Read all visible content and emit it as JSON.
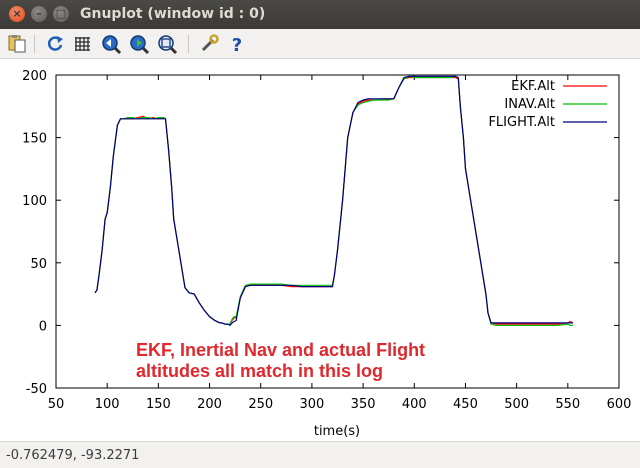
{
  "window": {
    "title": "Gnuplot (window id : 0)"
  },
  "toolbar": {
    "buttons": [
      {
        "icon": "copy-clipboard-icon"
      },
      {
        "icon": "replot-icon"
      },
      {
        "icon": "grid-icon"
      },
      {
        "icon": "zoom-previous-icon"
      },
      {
        "icon": "zoom-next-icon"
      },
      {
        "icon": "autoscale-icon"
      },
      {
        "icon": "settings-icon"
      },
      {
        "icon": "help-icon"
      }
    ]
  },
  "status": {
    "coordinates": "-0.762479, -93.2271"
  },
  "chart_data": {
    "type": "line",
    "xlabel": "time(s)",
    "ylabel": "",
    "xlim": [
      50,
      600
    ],
    "ylim": [
      -50,
      200
    ],
    "xticks": [
      "50",
      "100",
      "150",
      "200",
      "250",
      "300",
      "350",
      "400",
      "450",
      "500",
      "550",
      "600"
    ],
    "yticks": [
      "-50",
      "0",
      "50",
      "100",
      "150",
      "200"
    ],
    "legend_position": "top-right",
    "annotation": [
      "EKF, Inertial Nav and actual Flight",
      "altitudes all match in this log"
    ],
    "series": [
      {
        "name": "EKF.Alt",
        "color": "#ff0000",
        "x": [
          88,
          90,
          92,
          95,
          98,
          100,
          103,
          106,
          110,
          113,
          116,
          120,
          125,
          130,
          135,
          140,
          145,
          150,
          155,
          157,
          160,
          163,
          165,
          168,
          172,
          176,
          180,
          185,
          190,
          195,
          200,
          205,
          210,
          212,
          215,
          218,
          220,
          222,
          224,
          226,
          230,
          235,
          240,
          250,
          260,
          270,
          280,
          290,
          300,
          310,
          320,
          322,
          325,
          330,
          335,
          340,
          345,
          350,
          355,
          360,
          365,
          370,
          375,
          380,
          385,
          390,
          395,
          400,
          405,
          410,
          415,
          420,
          425,
          430,
          435,
          440,
          443,
          445,
          448,
          450,
          455,
          460,
          465,
          470,
          472,
          475,
          480,
          490,
          500,
          510,
          520,
          530,
          540,
          550,
          552,
          555
        ],
        "y": [
          26,
          28,
          40,
          60,
          85,
          90,
          110,
          135,
          160,
          165,
          165,
          165,
          165,
          166,
          167,
          165,
          166,
          165,
          166,
          165,
          140,
          110,
          85,
          70,
          50,
          30,
          26,
          25,
          18,
          12,
          7,
          4,
          2,
          2,
          1,
          1,
          1,
          4,
          6,
          6,
          22,
          31,
          32,
          32,
          32,
          32,
          31,
          31,
          31,
          31,
          31,
          40,
          60,
          100,
          150,
          170,
          177,
          179,
          180,
          180,
          180,
          181,
          181,
          181,
          190,
          197,
          198,
          198,
          198,
          198,
          198,
          198,
          198,
          198,
          198,
          198,
          197,
          175,
          150,
          125,
          100,
          75,
          50,
          25,
          10,
          2,
          1,
          1,
          1,
          1,
          1,
          1,
          1,
          2,
          3,
          2
        ]
      },
      {
        "name": "INAV.Alt",
        "color": "#00c000",
        "x": [
          88,
          90,
          92,
          95,
          98,
          100,
          103,
          106,
          110,
          113,
          116,
          120,
          125,
          130,
          135,
          140,
          145,
          150,
          155,
          157,
          160,
          163,
          165,
          168,
          172,
          176,
          180,
          185,
          190,
          195,
          200,
          205,
          210,
          212,
          215,
          218,
          220,
          222,
          224,
          226,
          230,
          235,
          240,
          250,
          260,
          270,
          280,
          290,
          300,
          310,
          320,
          322,
          325,
          330,
          335,
          340,
          345,
          350,
          355,
          360,
          365,
          370,
          375,
          380,
          385,
          390,
          395,
          400,
          405,
          410,
          415,
          420,
          425,
          430,
          435,
          440,
          443,
          445,
          448,
          450,
          455,
          460,
          465,
          470,
          472,
          475,
          480,
          490,
          500,
          510,
          520,
          530,
          540,
          550,
          552,
          555
        ],
        "y": [
          26,
          28,
          40,
          60,
          85,
          90,
          110,
          135,
          160,
          165,
          165,
          166,
          166,
          165,
          166,
          166,
          165,
          166,
          166,
          165,
          140,
          110,
          85,
          70,
          50,
          30,
          26,
          25,
          18,
          12,
          7,
          4,
          2,
          2,
          1,
          1,
          1,
          5,
          7,
          7,
          23,
          32,
          33,
          33,
          33,
          33,
          32,
          32,
          32,
          32,
          32,
          40,
          60,
          100,
          150,
          170,
          176,
          178,
          179,
          180,
          180,
          180,
          180,
          181,
          190,
          197,
          199,
          198,
          198,
          198,
          198,
          198,
          198,
          198,
          198,
          199,
          198,
          175,
          150,
          125,
          100,
          75,
          50,
          25,
          10,
          1,
          0,
          0,
          0,
          0,
          0,
          0,
          0,
          1,
          0,
          0
        ]
      },
      {
        "name": "FLIGHT.Alt",
        "color": "#000080",
        "x": [
          88,
          90,
          92,
          95,
          98,
          100,
          103,
          106,
          110,
          113,
          116,
          120,
          125,
          130,
          135,
          140,
          145,
          150,
          155,
          157,
          160,
          163,
          165,
          168,
          172,
          176,
          180,
          185,
          190,
          195,
          200,
          205,
          210,
          212,
          215,
          218,
          220,
          222,
          224,
          226,
          230,
          235,
          240,
          250,
          260,
          270,
          280,
          290,
          300,
          310,
          320,
          322,
          325,
          330,
          335,
          340,
          345,
          350,
          355,
          360,
          365,
          370,
          375,
          380,
          385,
          390,
          395,
          400,
          405,
          410,
          415,
          420,
          425,
          430,
          435,
          440,
          443,
          445,
          448,
          450,
          455,
          460,
          465,
          470,
          472,
          475,
          480,
          490,
          500,
          510,
          520,
          530,
          540,
          550,
          552,
          555
        ],
        "y": [
          26,
          28,
          40,
          60,
          85,
          90,
          110,
          135,
          160,
          165,
          165,
          165,
          165,
          165,
          165,
          165,
          165,
          165,
          165,
          165,
          140,
          110,
          85,
          70,
          50,
          30,
          26,
          25,
          18,
          12,
          7,
          4,
          2,
          2,
          1,
          1,
          0,
          2,
          3,
          4,
          22,
          31,
          32,
          32,
          32,
          32,
          32,
          31,
          31,
          31,
          31,
          40,
          60,
          100,
          150,
          170,
          178,
          180,
          181,
          181,
          181,
          181,
          181,
          181,
          190,
          198,
          199,
          199,
          199,
          199,
          199,
          199,
          199,
          199,
          199,
          199,
          198,
          175,
          150,
          125,
          100,
          75,
          50,
          25,
          10,
          2,
          2,
          2,
          2,
          2,
          2,
          2,
          2,
          2,
          2,
          2
        ]
      }
    ]
  }
}
